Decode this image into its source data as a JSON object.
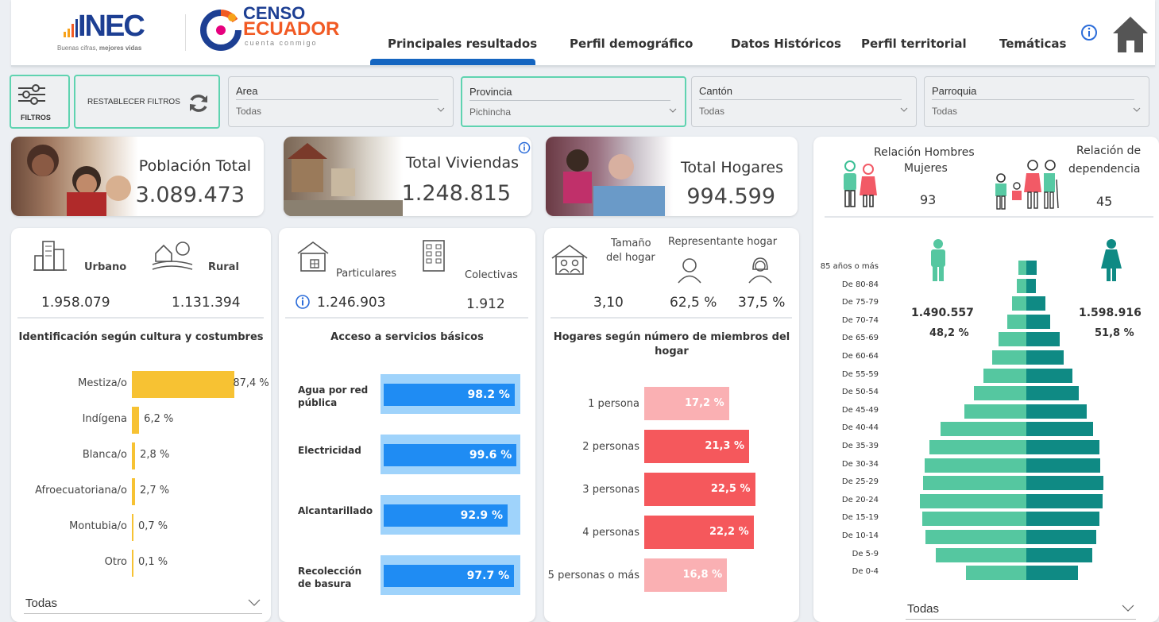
{
  "header": {
    "inec_name": "INEC",
    "inec_tagline_pre": "Buenas cifras, ",
    "inec_tagline_bold": "mejores vidas",
    "censo_line1": "CENSO",
    "censo_line2": "ECUADOR",
    "censo_tagline": "cuenta conmigo",
    "nav": [
      "Principales resultados",
      "Perfil demográfico",
      "Datos Históricos",
      "Perfil territorial",
      "Temáticas"
    ],
    "active_nav": 0,
    "info_icon": "info-icon",
    "home_icon": "home-icon"
  },
  "filters": {
    "filters_label": "FILTROS",
    "reset_label": "RESTABLECER FILTROS",
    "area": {
      "label": "Area",
      "value": "Todas"
    },
    "provincia": {
      "label": "Provincia",
      "value": "Pichincha"
    },
    "canton": {
      "label": "Cantón",
      "value": "Todas"
    },
    "parroquia": {
      "label": "Parroquia",
      "value": "Todas"
    }
  },
  "kpis": {
    "poblacion": {
      "title": "Población Total",
      "value": "3.089.473"
    },
    "viviendas": {
      "title": "Total Viviendas",
      "value": "1.248.815"
    },
    "hogares": {
      "title": "Total Hogares",
      "value": "994.599"
    },
    "relacion_hm": {
      "title1": "Relación Hombres",
      "title2": "Mujeres",
      "value": "93"
    },
    "dependencia": {
      "title1": "Relación de",
      "title2": "dependencia",
      "value": "45"
    }
  },
  "poblacion": {
    "urbano_label": "Urbano",
    "urbano_value": "1.958.079",
    "rural_label": "Rural",
    "rural_value": "1.131.394",
    "cultura_title": "Identificación según cultura y costumbres",
    "dropdown": "Todas"
  },
  "viviendas": {
    "particulares_label": "Particulares",
    "particulares_value": "1.246.903",
    "colectivas_label": "Colectivas",
    "colectivas_value": "1.912",
    "servicios_title": "Acceso a servicios básicos"
  },
  "hogares": {
    "tamano_label1": "Tamaño",
    "tamano_label2": "del hogar",
    "tamano_value": "3,10",
    "representante_label": "Representante hogar",
    "rep_hombre": "62,5 %",
    "rep_mujer": "37,5 %",
    "miembros_title1": "Hogares según número de miembros del",
    "miembros_title2": "hogar"
  },
  "piramide": {
    "hombres_value": "1.490.557",
    "hombres_pct": "48,2 %",
    "mujeres_value": "1.598.916",
    "mujeres_pct": "51,8 %",
    "dropdown": "Todas"
  },
  "chart_data": [
    {
      "type": "bar",
      "title": "Identificación según cultura y costumbres",
      "categories": [
        "Mestiza/o",
        "Indígena",
        "Blanca/o",
        "Afroecuatoriana/o",
        "Montubia/o",
        "Otro"
      ],
      "values": [
        87.4,
        6.2,
        2.8,
        2.7,
        0.7,
        0.1
      ],
      "labels": [
        "87,4 %",
        "6,2 %",
        "2,8 %",
        "2,7 %",
        "0,7 %",
        "0,1 %"
      ],
      "color": "#f7c233"
    },
    {
      "type": "bar",
      "title": "Acceso a servicios básicos",
      "categories": [
        "Agua por red pública",
        "Electricidad",
        "Alcantarillado",
        "Recolección de basura"
      ],
      "values": [
        98.2,
        99.6,
        92.9,
        97.7
      ],
      "labels": [
        "98.2 %",
        "99.6 %",
        "92.9 %",
        "97.7 %"
      ],
      "color": "#1f8cf3"
    },
    {
      "type": "bar",
      "title": "Hogares según número de miembros del hogar",
      "categories": [
        "1 persona",
        "2 personas",
        "3 personas",
        "4 personas",
        "5 personas o más"
      ],
      "values": [
        17.2,
        21.3,
        22.5,
        22.2,
        16.8
      ],
      "labels": [
        "17,2 %",
        "21,3 %",
        "22,5 %",
        "22,2 %",
        "16,8 %"
      ],
      "colors": [
        "#fab0b3",
        "#f5585c",
        "#f5585c",
        "#f5585c",
        "#fab0b3"
      ]
    },
    {
      "type": "bar",
      "categories": [
        "85 años o más",
        "De 80-84",
        "De 75-79",
        "De 70-74",
        "De 65-69",
        "De 60-64",
        "De 55-59",
        "De 50-54",
        "De 45-49",
        "De 40-44",
        "De 35-39",
        "De 30-34",
        "De 25-29",
        "De 20-24",
        "De 15-19",
        "De 10-14",
        "De 5-9",
        "De 0-4"
      ],
      "series": [
        {
          "values": [
            0.25,
            0.28,
            0.42,
            0.57,
            0.84,
            1.02,
            1.28,
            1.56,
            1.85,
            2.58,
            2.9,
            3.05,
            3.1,
            3.18,
            3.12,
            3.02,
            2.72,
            1.8
          ],
          "color": "#55c7a0"
        },
        {
          "values": [
            0.32,
            0.28,
            0.58,
            0.72,
            1.0,
            1.12,
            1.38,
            1.56,
            1.82,
            2.0,
            2.2,
            2.22,
            2.3,
            2.28,
            2.2,
            2.1,
            1.98,
            1.54
          ],
          "color": "#0f8a84"
        }
      ]
    }
  ]
}
